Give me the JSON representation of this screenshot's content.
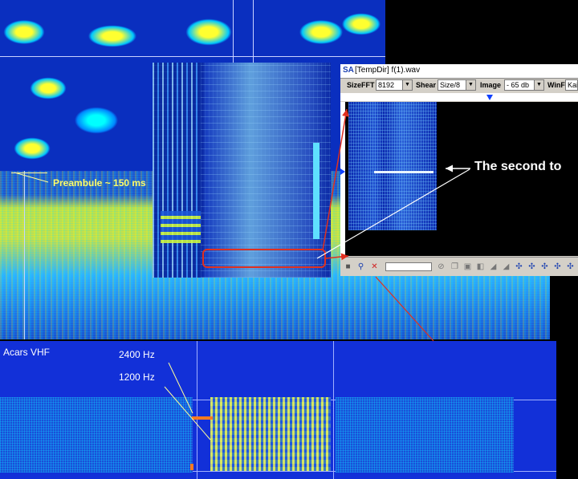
{
  "top_annotations": {
    "preamble": "Preambule ~ 150 ms"
  },
  "sa_window": {
    "app_icon": "SA",
    "title": "[TempDir] f(1).wav",
    "toolbar": {
      "size_fft_label": "SizeFFT",
      "size_fft_value": "8192",
      "shear_label": "Shear",
      "shear_value": "Size/8",
      "image_label": "Image",
      "image_value": "- 65 db",
      "winf_label": "WinF",
      "winf_value": "Kai"
    }
  },
  "annotation_text": "The second to",
  "acars": {
    "title": "Acars VHF",
    "freq_high": "2400 Hz",
    "freq_low": "1200 Hz"
  },
  "colors": {
    "spectrogram_background": "#1230d8",
    "annotation_arrow": "#e03020",
    "label_yellow": "#ffff66",
    "marker_orange": "#ff7a20"
  }
}
